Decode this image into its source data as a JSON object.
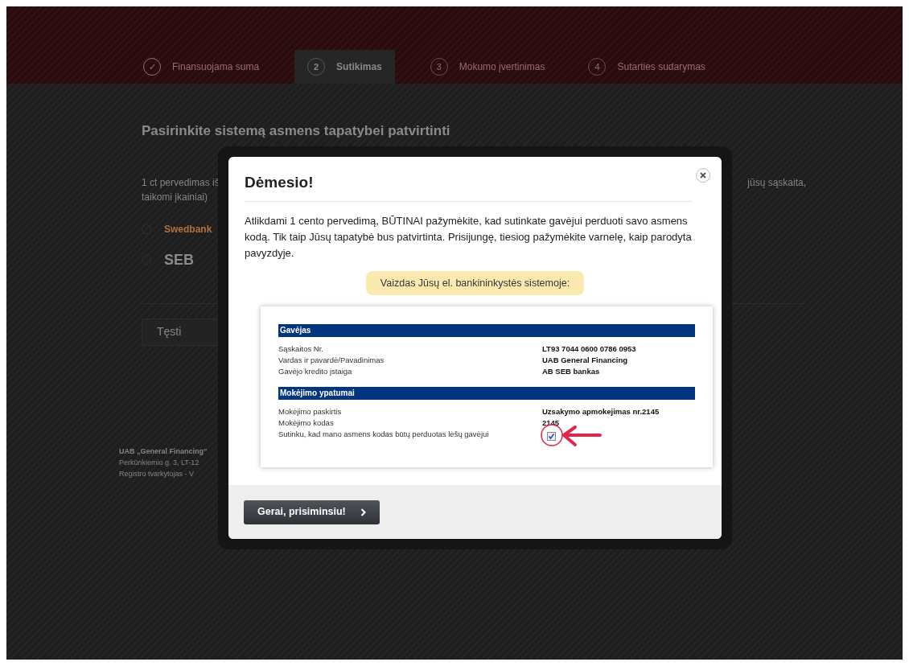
{
  "steps": [
    {
      "number": "✓",
      "label": "Finansuojama suma",
      "selected": false,
      "done": true
    },
    {
      "number": "2",
      "label": "Sutikimas",
      "selected": true,
      "done": false
    },
    {
      "number": "3",
      "label": "Mokumo įvertinimas",
      "selected": false,
      "done": false
    },
    {
      "number": "4",
      "label": "Sutarties sudarymas",
      "selected": false,
      "done": false
    }
  ],
  "page": {
    "heading": "Pasirinkite sistemą asmens tapatybei patvirtinti",
    "intro_left": [
      "1 ct pervedimas iš",
      "taikomi įkainiai)"
    ],
    "intro_right": "jūsų sąskaita,",
    "banks": [
      {
        "label": "Swedbank",
        "selected": false
      },
      {
        "label": "SEB",
        "selected": true
      }
    ],
    "continue_button": "Tęsti",
    "footer": [
      "UAB „General Financing“",
      "Perkūnkiemio g. 3, LT-12",
      "Registro tvarkytojas - V"
    ]
  },
  "modal": {
    "title": "Dėmesio!",
    "message": "Atlikdami 1 cento pervedimą, BŪTINAI pažymėkite, kad sutinkate gavėjui perduoti savo asmens kodą. Tik taip Jūsų tapatybė bus patvirtinta. Prisijungę, tiesiog pažymėkite varnelę, kaip parodyta pavyzdyje.",
    "note": "Vaizdas Jūsų el. bankininkystės sistemoje:",
    "sample": {
      "sections": [
        {
          "title": "Gavėjas",
          "rows": [
            {
              "label": "Sąskaitos Nr.",
              "value": "LT93 7044 0600 0786 0953",
              "kind": "text"
            },
            {
              "label": "Vardas ir pavardė/Pavadinimas",
              "value": "UAB General Financing",
              "kind": "text"
            },
            {
              "label": "Gavėjo kredito įstaiga",
              "value": "AB SEB bankas",
              "kind": "text"
            }
          ]
        },
        {
          "title": "Mokėjimo ypatumai",
          "rows": [
            {
              "label": "Mokėjimo paskirtis",
              "value": "Uzsakymo apmokejimas nr.2145",
              "kind": "text"
            },
            {
              "label": "Mokėjimo kodas",
              "value": "2145",
              "kind": "text"
            },
            {
              "label": "Sutinku, kad mano asmens kodas būtų perduotas lėšų gavėjui",
              "checked": true,
              "kind": "checkbox"
            }
          ]
        }
      ]
    },
    "button": "Gerai, prisiminsiu!"
  }
}
